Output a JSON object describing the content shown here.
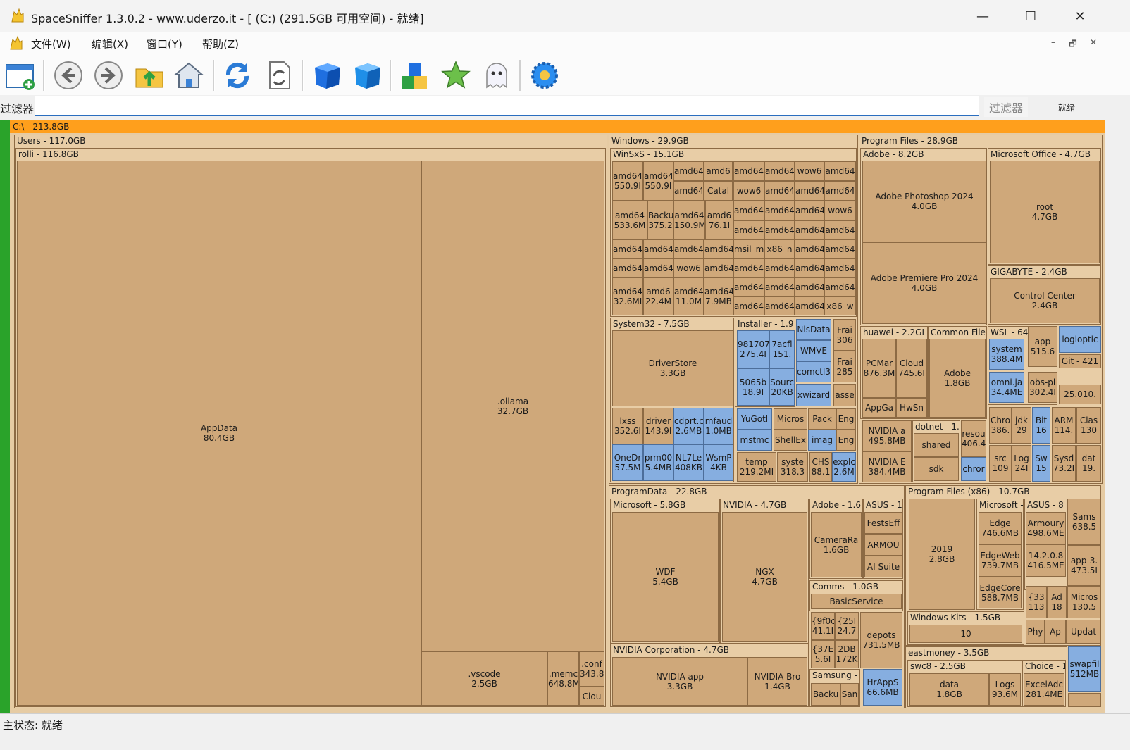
{
  "window": {
    "title": "SpaceSniffer 1.3.0.2 - www.uderzo.it - [ (C:) (291.5GB 可用空间) - 就绪]",
    "minimize": "—",
    "maximize": "☐",
    "close": "✕"
  },
  "menu": {
    "items": [
      "文件(W)",
      "编辑(X)",
      "窗口(Y)",
      "帮助(Z)"
    ],
    "mdi": [
      "–",
      "🗗",
      "✕"
    ]
  },
  "toolbar": {
    "icons": [
      "new-view-icon",
      "back-icon",
      "forward-icon",
      "folder-up-icon",
      "home-icon",
      "refresh-icon",
      "rescan-icon",
      "blue-cube-icon",
      "blue-cube-2-icon",
      "blocks-icon",
      "star-icon",
      "ghost-icon",
      "settings-gear-icon"
    ]
  },
  "filter": {
    "label": "过滤器",
    "value": "",
    "button": "过滤器",
    "state": "就绪"
  },
  "status": {
    "text": "主状态: 就绪"
  },
  "colors": {
    "root_bar": "#ff9f1c",
    "green_bar": "#2aa32a",
    "folder": "#cfa87a",
    "file": "#86aee0"
  },
  "treemap": {
    "root": "C:\\ - 213.8GB",
    "users": "Users - 117.0GB",
    "rolli": "rolli - 116.8GB",
    "appdata": "AppData\n80.4GB",
    "ollama": ".ollama\n32.7GB",
    "vscode": ".vscode\n2.5GB",
    "memc": ".memc\n648.8M",
    "conf": ".conf\n343.8",
    "cloud": "Clou",
    "windows": "Windows - 29.9GB",
    "winsxs": "WinSxS - 15.1GB",
    "system32": "System32 - 7.5GB",
    "driverstore": "DriverStore\n3.3GB",
    "installer": "Installer - 1.9",
    "programfiles": "Program Files - 28.9GB",
    "adobe": "Adobe - 8.2GB",
    "photoshop": "Adobe Photoshop 2024\n4.0GB",
    "premiere": "Adobe Premiere Pro 2024\n4.0GB",
    "msoffice": "Microsoft Office - 4.7GB",
    "root47": "root\n4.7GB",
    "gigabyte": "GIGABYTE - 2.4GB",
    "controlcenter": "Control Center\n2.4GB",
    "huawei": "huawei - 2.2GI",
    "pcmar": "PCMar\n876.3M",
    "cloud2": "Cloud\n745.6I",
    "appga": "AppGa",
    "hwsn": "HwSn",
    "commonfile": "Common File",
    "adobe18": "Adobe\n1.8GB",
    "wsl": "WSL - 64",
    "system388": "system\n388.4M",
    "omni": "omni.ja\n34.4ME",
    "app515": "app\n515.6",
    "obspl": "obs-pl\n302.4I",
    "logioptic": "logioptic",
    "git": "Git - 421",
    "s25010": "25.010.",
    "nvidia1": "NVIDIA a\n495.8MB",
    "nvidia2": "NVIDIA E\n384.4MB",
    "dotnet": "dotnet - 1.",
    "shared": "shared",
    "sdk": "sdk",
    "resou": "resou\n406.4",
    "chror": "chror",
    "programdata": "ProgramData - 22.8GB",
    "pd_ms": "Microsoft - 5.8GB",
    "wdf": "WDF\n5.4GB",
    "pd_nv": "NVIDIA - 4.7GB",
    "ngx": "NGX\n4.7GB",
    "pd_adobe": "Adobe - 1.6",
    "cameraraw": "CameraRa\n1.6GB",
    "pd_asus": "ASUS - 1",
    "festseff": "FestsEff",
    "armou": "ARMOU",
    "aisuite": "AI Suite",
    "comms": "Comms - 1.0GB",
    "basicservice": "BasicService",
    "nvcorp": "NVIDIA Corporation - 4.7GB",
    "nvapp": "NVIDIA app\n3.3GB",
    "nvbro": "NVIDIA Bro\n1.4GB",
    "depots": "depots\n731.5MB",
    "samsung": "Samsung -",
    "backu": "Backu",
    "san": "San",
    "hrapps": "HrAppS\n66.6MB",
    "pf86": "Program Files (x86) - 10.7GB",
    "y2019": "2019\n2.8GB",
    "pf86_ms": "Microsoft -",
    "edge": "Edge\n746.6MB",
    "edgeweb": "EdgeWeb\n739.7MB",
    "edgecore": "EdgeCore\n588.7MB",
    "pf86_asus": "ASUS - 8",
    "armoury": "Armoury\n498.6ME",
    "v1420": "14.2.0.8\n416.5ME",
    "sams": "Sams\n638.5",
    "app3": "app-3.\n473.5I",
    "micros130": "Micros\n130.5",
    "winkits": "Windows Kits - 1.5GB",
    "ten": "10",
    "eastmoney": "eastmoney - 3.5GB",
    "swc8": "swc8 - 2.5GB",
    "data18": "data\n1.8GB",
    "logs": "Logs\n93.6M",
    "choice": "Choice - 1",
    "exceladc": "ExcelAdc\n281.4ME",
    "swapfil": "swapfil\n512MB",
    "phy": "Phy",
    "ap": "Ap",
    "updat": "Updat",
    "s33": "{33\n113",
    "ad18": "Ad\n18",
    "winsxs_cells": [
      "amd64\n550.9I",
      "amd64\n550.9I",
      "amd64",
      "amd6",
      "amd64",
      "amd64",
      "wow6",
      "amd64",
      "amd64",
      "Catal",
      "wow6",
      "amd64",
      "amd64",
      "amd64",
      "amd64\n533.6M",
      "Backu\n375.2",
      "amd64\n150.9M",
      "amd6\n76.1I",
      "amd64",
      "amd64",
      "amd64",
      "wow6",
      "amd64",
      "amd64",
      "amd64",
      "amd64",
      "amd64",
      "amd64",
      "amd64",
      "amd64",
      "msil_m",
      "x86_n",
      "amd64",
      "amd64",
      "amd64",
      "amd64",
      "wow6",
      "amd64",
      "amd64",
      "amd64",
      "amd64",
      "amd64",
      "amd64\n32.6MI",
      "amd6\n22.4M",
      "amd64\n11.0M",
      "amd64\n7.9MB",
      "amd64",
      "amd64",
      "amd64",
      "amd64",
      "amd64",
      "amd64",
      "amd64",
      "x86_w"
    ],
    "sys32_cells": [
      "lxss\n352.6I",
      "driver\n143.9I",
      "cdprt.c\n2.6MB",
      "mfaud\n1.0MB",
      "OneDr\n57.5M",
      "prm00\n5.4MB",
      "NL7Le\n408KB",
      "WsmP\n4KB"
    ],
    "installer_cells": [
      "981707\n275.4I",
      "7acfl\n151.",
      "5065b\n18.9I",
      "Sourc\n20KB"
    ],
    "win_misc": [
      "NlsData",
      "WMVE",
      "comctl3",
      "xwizard",
      "Frai\n306",
      "Frai\n285",
      "asse",
      "YuGotl",
      "mstmc",
      "Micros",
      "ShellEx",
      "Pack",
      "imag",
      "Eng",
      "Eng",
      "temp\n219.2MI",
      "syste\n318.3",
      "CHS\n88.1",
      "explc\n2.6M"
    ],
    "pf_misc": [
      "Chro\n386.",
      "jdk\n29",
      "Bit\n16",
      "ARM\n114.",
      "Clas\n130",
      "src\n109",
      "Log\n24I",
      "Sw\n15",
      "Sysd\n73.2I",
      "dat\n19."
    ],
    "pd_misc": [
      "{9f0c\n41.1I",
      "{25I\n24.7",
      "{37E\n5.6I",
      "2DB\n172K"
    ]
  }
}
